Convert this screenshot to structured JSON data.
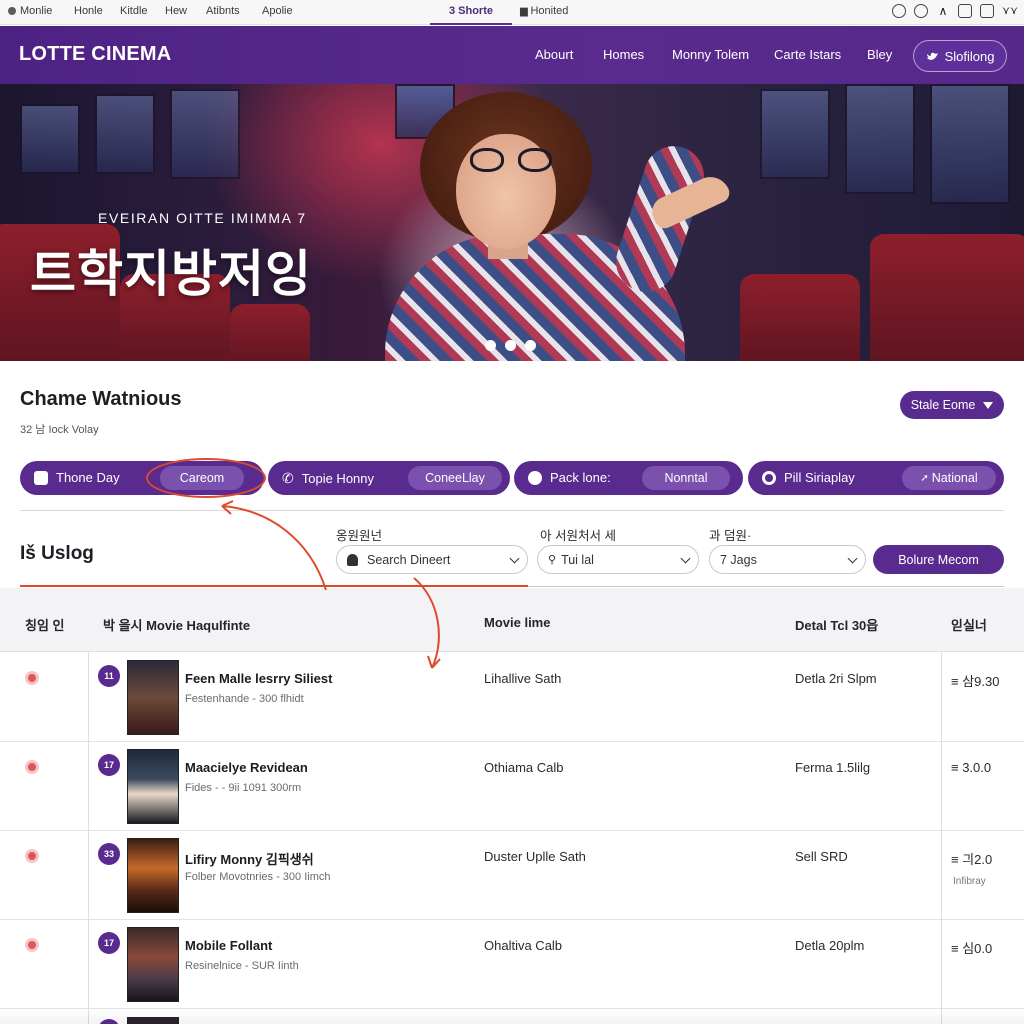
{
  "browser": {
    "tabs": [
      "Monlie",
      "Honle",
      "Kitdle",
      "Hew",
      "Atibnts",
      "Apolie"
    ],
    "active_tab": "3 Shorte",
    "second_tab": "Honited"
  },
  "header": {
    "logo": "LOTTE CINEMA",
    "nav": [
      "Abourt",
      "Homes",
      "Monny Tolem",
      "Carte Istars",
      "Bley"
    ],
    "schedule_button": "Slofilong"
  },
  "hero": {
    "subtitle": "EVEIRAN OITTE IMIMMA 7",
    "title": "트학지방저잉",
    "slides": 3
  },
  "section": {
    "title": "Chame Watnious",
    "subtitle": "32 남 Iock Volay",
    "state_button": "Stale Eome"
  },
  "filters": [
    {
      "label": "Thone Day",
      "value": "Careom"
    },
    {
      "label": "Topie Honny",
      "value": "ConeeLlay"
    },
    {
      "label": "Pack lone:",
      "value": "Nonntal"
    },
    {
      "label": "Pill Siriaplay",
      "value": "National"
    }
  ],
  "listing": {
    "title": "Iš Uslog",
    "filter_labels": [
      "옹원원넌",
      "아 서원처서 세",
      "과 덤원·"
    ],
    "search_placeholder": "Search Dineert",
    "select_two": "Tui lal",
    "select_three": "7  Jags",
    "apply_button": "Bolure Mecom"
  },
  "table": {
    "headers": [
      "칭임 인",
      "박 을시 Movie Haqulfinte",
      "Movie lime",
      "Detal Tcl 30읍",
      "읻실너"
    ],
    "rows": [
      {
        "rank": "11",
        "title": "Feen Malle lesrry Siliest",
        "sub": "Festenhande - 300 flhidt",
        "location": "Lihallive Sath",
        "detail": "Detla 2ri Slpm",
        "price": "≡ 삼9.30",
        "note": ""
      },
      {
        "rank": "17",
        "title": "Maacielye Revidean",
        "sub": "Fides - - 9ii 1091 300rm",
        "location": "Othiama Calb",
        "detail": "Ferma 1.5lilg",
        "price": "≡ 3.0.0",
        "note": ""
      },
      {
        "rank": "33",
        "title": "Lifiry Monny 김픽생쉬",
        "sub": "Folber Movotnries - 300 Iimch",
        "location": "Duster Uplle Sath",
        "detail": "Sell SRD",
        "price": "≡ 긔2.0",
        "note": "Infibray"
      },
      {
        "rank": "17",
        "title": "Mobile Follant",
        "sub": "Resinelnice - SUR Iinth",
        "location": "Ohaltiva Calb",
        "detail": "Detla 20plm",
        "price": "≡ 심0.0",
        "note": ""
      }
    ]
  },
  "colors": {
    "brand": "#5a2b8f",
    "accent_red": "#e04a2c",
    "status_dot": "#e05555"
  }
}
